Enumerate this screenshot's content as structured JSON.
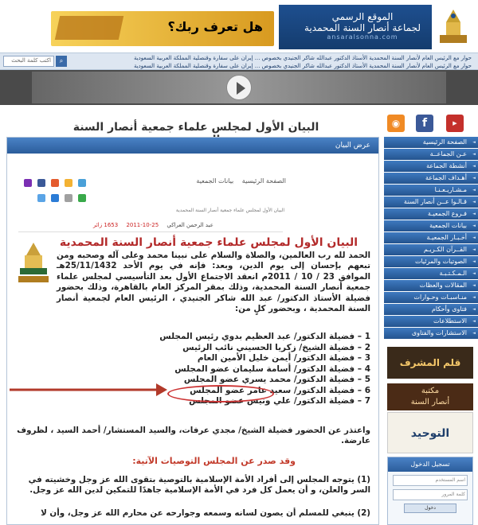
{
  "header": {
    "site_title_line1": "الموقع الرسمي",
    "site_title_line2": "لجماعة أنصار السنة المحمدية",
    "site_url": "ansaralsonna.com",
    "banner_text": "هل تعرف ربك؟"
  },
  "ticker": {
    "row1": "حوار مع الرئيس العام لأنصار السنة المحمدية الأستاذ الدكتور عبدالله شاكر الجنيدي بخصوص ... إيران على سفارة وقنصلية المملكة العربية السعودية",
    "row2": "حوار مع الرئيس العام لأنصار السنة المحمدية الأستاذ الدكتور عبدالله شاكر الجنيدي بخصوص ... إيران على سفارة وقنصلية المملكة العربية السعودية",
    "search_placeholder": "اكتب كلمة البحث"
  },
  "page_title": "البيان الأول لمجلس علماء جمعية أنصار السنة المحمدية",
  "content": {
    "header": "عرض البيان",
    "nav_home": "الصفحة الرئيسية",
    "nav_statements": "بيانات الجمعية",
    "breadcrumb": "البيان الأول لمجلس علماء جمعية أنصار السنة المحمدية",
    "author": "عبد الرحمن العراكي",
    "date": "25-10-2011",
    "views": "1653 زائر",
    "article_title": "البيان الأول لمجلس علماء جمعية أنصار السنة المحمدية",
    "intro": "الحمد لله رب العالمين، والصلاة والسلام على نبينا محمد وعلى آله وصحبه ومن تبعهم بإحسان إلى يوم الدين، وبعد: فإنه في يوم الأحد 25/11/1432هـ الموافق 23 / 10 / 2011م انعقد الاجتماع الأول بعد التأسيسي لمجلس علماء جمعية أنصار السنة المحمدية، وذلك بمقر المركز العام بالقاهرة، وذلك بحضور فضيلة الأستاذ الدكتور/ عبد الله شاكر الجنيدي ، الرئيس العام لجمعية أنصار السنة المحمدية ، وبحضور كلٍ من:",
    "members": [
      "1 – فضيلة الدكتور/ عبد العظيم بدوي رئيس المجلس",
      "2 – فضيلة الشيخ/ زكريا الحسيني نائب الرئيس",
      "3 – فضيلة الدكتور/ أيمن خليل الأمين العام",
      "4 – فضيلة الدكتور/ أسامة سليمان عضو المجلس",
      "5 – فضيلة الدكتور/ محمد يسري عضو المجلس",
      "6 – فضيلة الدكتور/ سعيد عامر عضو المجلس",
      "7 – فضيلة الدكتور/ علي ونيس عضو المجلس"
    ],
    "apology": "واعتذر عن الحضور فضيلة الشيخ/ مجدي عرفات، والسيد المستشار/ أحمد السيد ، لظروف عارضة.",
    "reco_title": "وقد صدر عن المجلس التوصيات الآتية:",
    "reco1": "(1) يتوجه المجلس إلى أفراد الأمة الإسلامية بالتوصية بتقوى الله عز وجل وخشيته في السر والعلن، و أن يعمل كل فرد في الأمة الإسلامية جاهدًا للتمكين لدين الله عز وجل.",
    "reco2": "(2) ينبغي للمسلم أن يصون لسانه وسمعه وجوارحه عن محارم الله عز وجل، وأن لا"
  },
  "sidebar": {
    "items": [
      "الصفحة الرئيسية",
      "عـن الجماعــة",
      "أنشطة الجماعة",
      "أهـداف الجماعة",
      "مـشـاريـعـنـا",
      "قـالـوا عــن أنصار السنة",
      "فـروع الجمعيـة",
      "بيانات الجمعية",
      "أخـبـار الجمعيـة",
      "القــرآن الكـريـم",
      "الصوتيات والمرئيات",
      "الـمـكـتـبـة",
      "المقالات والعظات",
      "منـاسبـات وحـوارات",
      "فتاوى وأحكام",
      "الاستطلاعات",
      "الاستشارات والفتاوى"
    ],
    "ad1": "قلم المشرف",
    "ad2_line1": "مكتبة",
    "ad2_line2": "أنصار السنة",
    "ad3": "التوحيد",
    "login_title": "تسجيل الدخول",
    "login_user": "اسم المستخدم",
    "login_pass": "كلمة المرور",
    "login_btn": "دخول"
  }
}
